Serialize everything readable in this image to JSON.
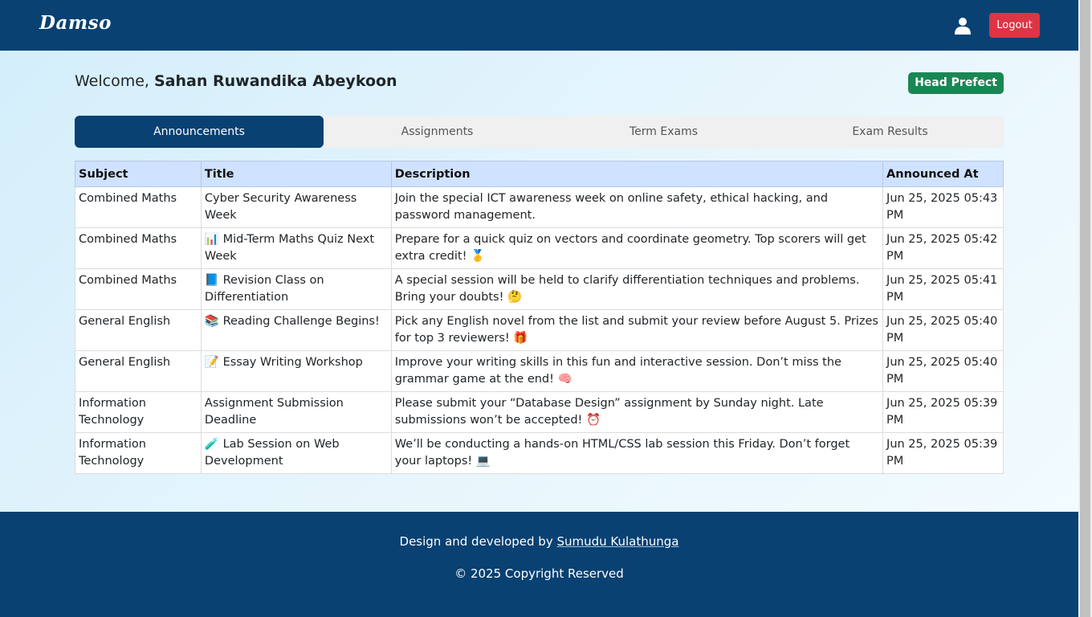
{
  "brand": "Damso",
  "header": {
    "logout_label": "Logout",
    "user_icon": "user-icon"
  },
  "welcome": {
    "prefix": "Welcome,",
    "name": "Sahan Ruwandika Abeykoon"
  },
  "role_badge": "Head Prefect",
  "tabs": [
    {
      "label": "Announcements",
      "active": true
    },
    {
      "label": "Assignments",
      "active": false
    },
    {
      "label": "Term Exams",
      "active": false
    },
    {
      "label": "Exam Results",
      "active": false
    }
  ],
  "table": {
    "headers": [
      "Subject",
      "Title",
      "Description",
      "Announced At"
    ],
    "rows": [
      [
        "Combined Maths",
        "Cyber Security Awareness Week",
        "Join the special ICT awareness week on online safety, ethical hacking, and password management.",
        "Jun 25, 2025 05:43 PM"
      ],
      [
        "Combined Maths",
        "📊 Mid-Term Maths Quiz Next Week",
        "Prepare for a quick quiz on vectors and coordinate geometry. Top scorers will get extra credit! 🥇",
        "Jun 25, 2025 05:42 PM"
      ],
      [
        "Combined Maths",
        "📘 Revision Class on Differentiation",
        "A special session will be held to clarify differentiation techniques and problems. Bring your doubts! 🤔",
        "Jun 25, 2025 05:41 PM"
      ],
      [
        "General English",
        "📚 Reading Challenge Begins!",
        "Pick any English novel from the list and submit your review before August 5. Prizes for top 3 reviewers! 🎁",
        "Jun 25, 2025 05:40 PM"
      ],
      [
        "General English",
        "📝 Essay Writing Workshop",
        "Improve your writing skills in this fun and interactive session. Don’t miss the grammar game at the end! 🧠",
        "Jun 25, 2025 05:40 PM"
      ],
      [
        "Information Technology",
        "Assignment Submission Deadline",
        "Please submit your “Database Design” assignment by Sunday night. Late submissions won’t be accepted! ⏰",
        "Jun 25, 2025 05:39 PM"
      ],
      [
        "Information Technology",
        "🧪 Lab Session on Web Development",
        "We’ll be conducting a hands-on HTML/CSS lab session this Friday. Don’t forget your laptops! 💻",
        "Jun 25, 2025 05:39 PM"
      ]
    ]
  },
  "footer": {
    "credit_prefix": "Design and developed by",
    "credit_name": "Sumudu Kulathunga",
    "copyright": "© 2025 Copyright Reserved"
  },
  "colors": {
    "primary": "#084172",
    "danger": "#dc3545",
    "success": "#198754",
    "table_header": "#cfe2ff"
  }
}
